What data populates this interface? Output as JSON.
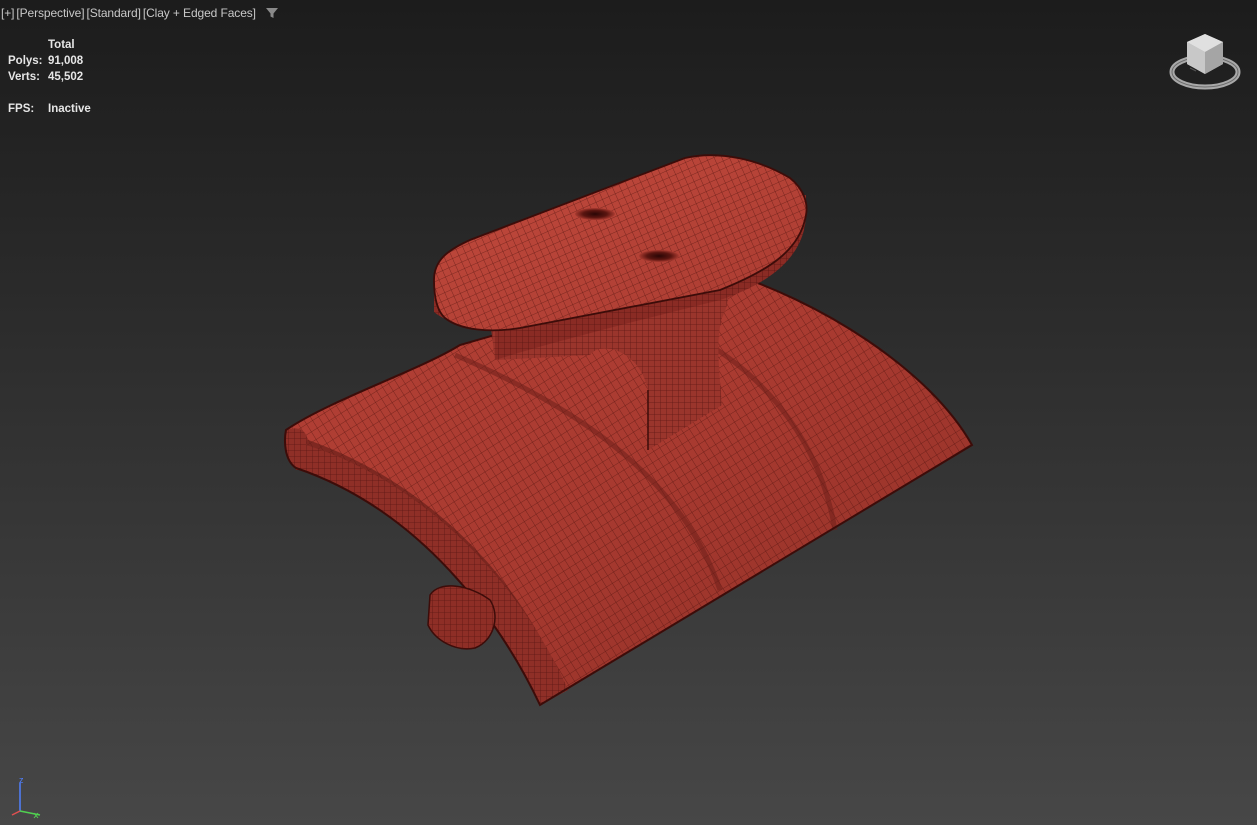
{
  "viewport": {
    "label_parts": [
      "[+]",
      "[Perspective]",
      "[Standard]",
      "[Clay + Edged Faces]"
    ],
    "filter_icon": "filter-icon"
  },
  "stats": {
    "header": "Total",
    "polys_label": "Polys:",
    "polys_value": "91,008",
    "verts_label": "Verts:",
    "verts_value": "45,502",
    "fps_label": "FPS:",
    "fps_value": "Inactive"
  },
  "viewcube": {
    "icon": "viewcube-icon"
  },
  "axis": {
    "z_label": "z",
    "colors": {
      "x": "#e05050",
      "y": "#50d050",
      "z": "#5080ff"
    }
  },
  "model": {
    "material_color": "#a83a30",
    "wire_color": "#4a0f0c"
  }
}
